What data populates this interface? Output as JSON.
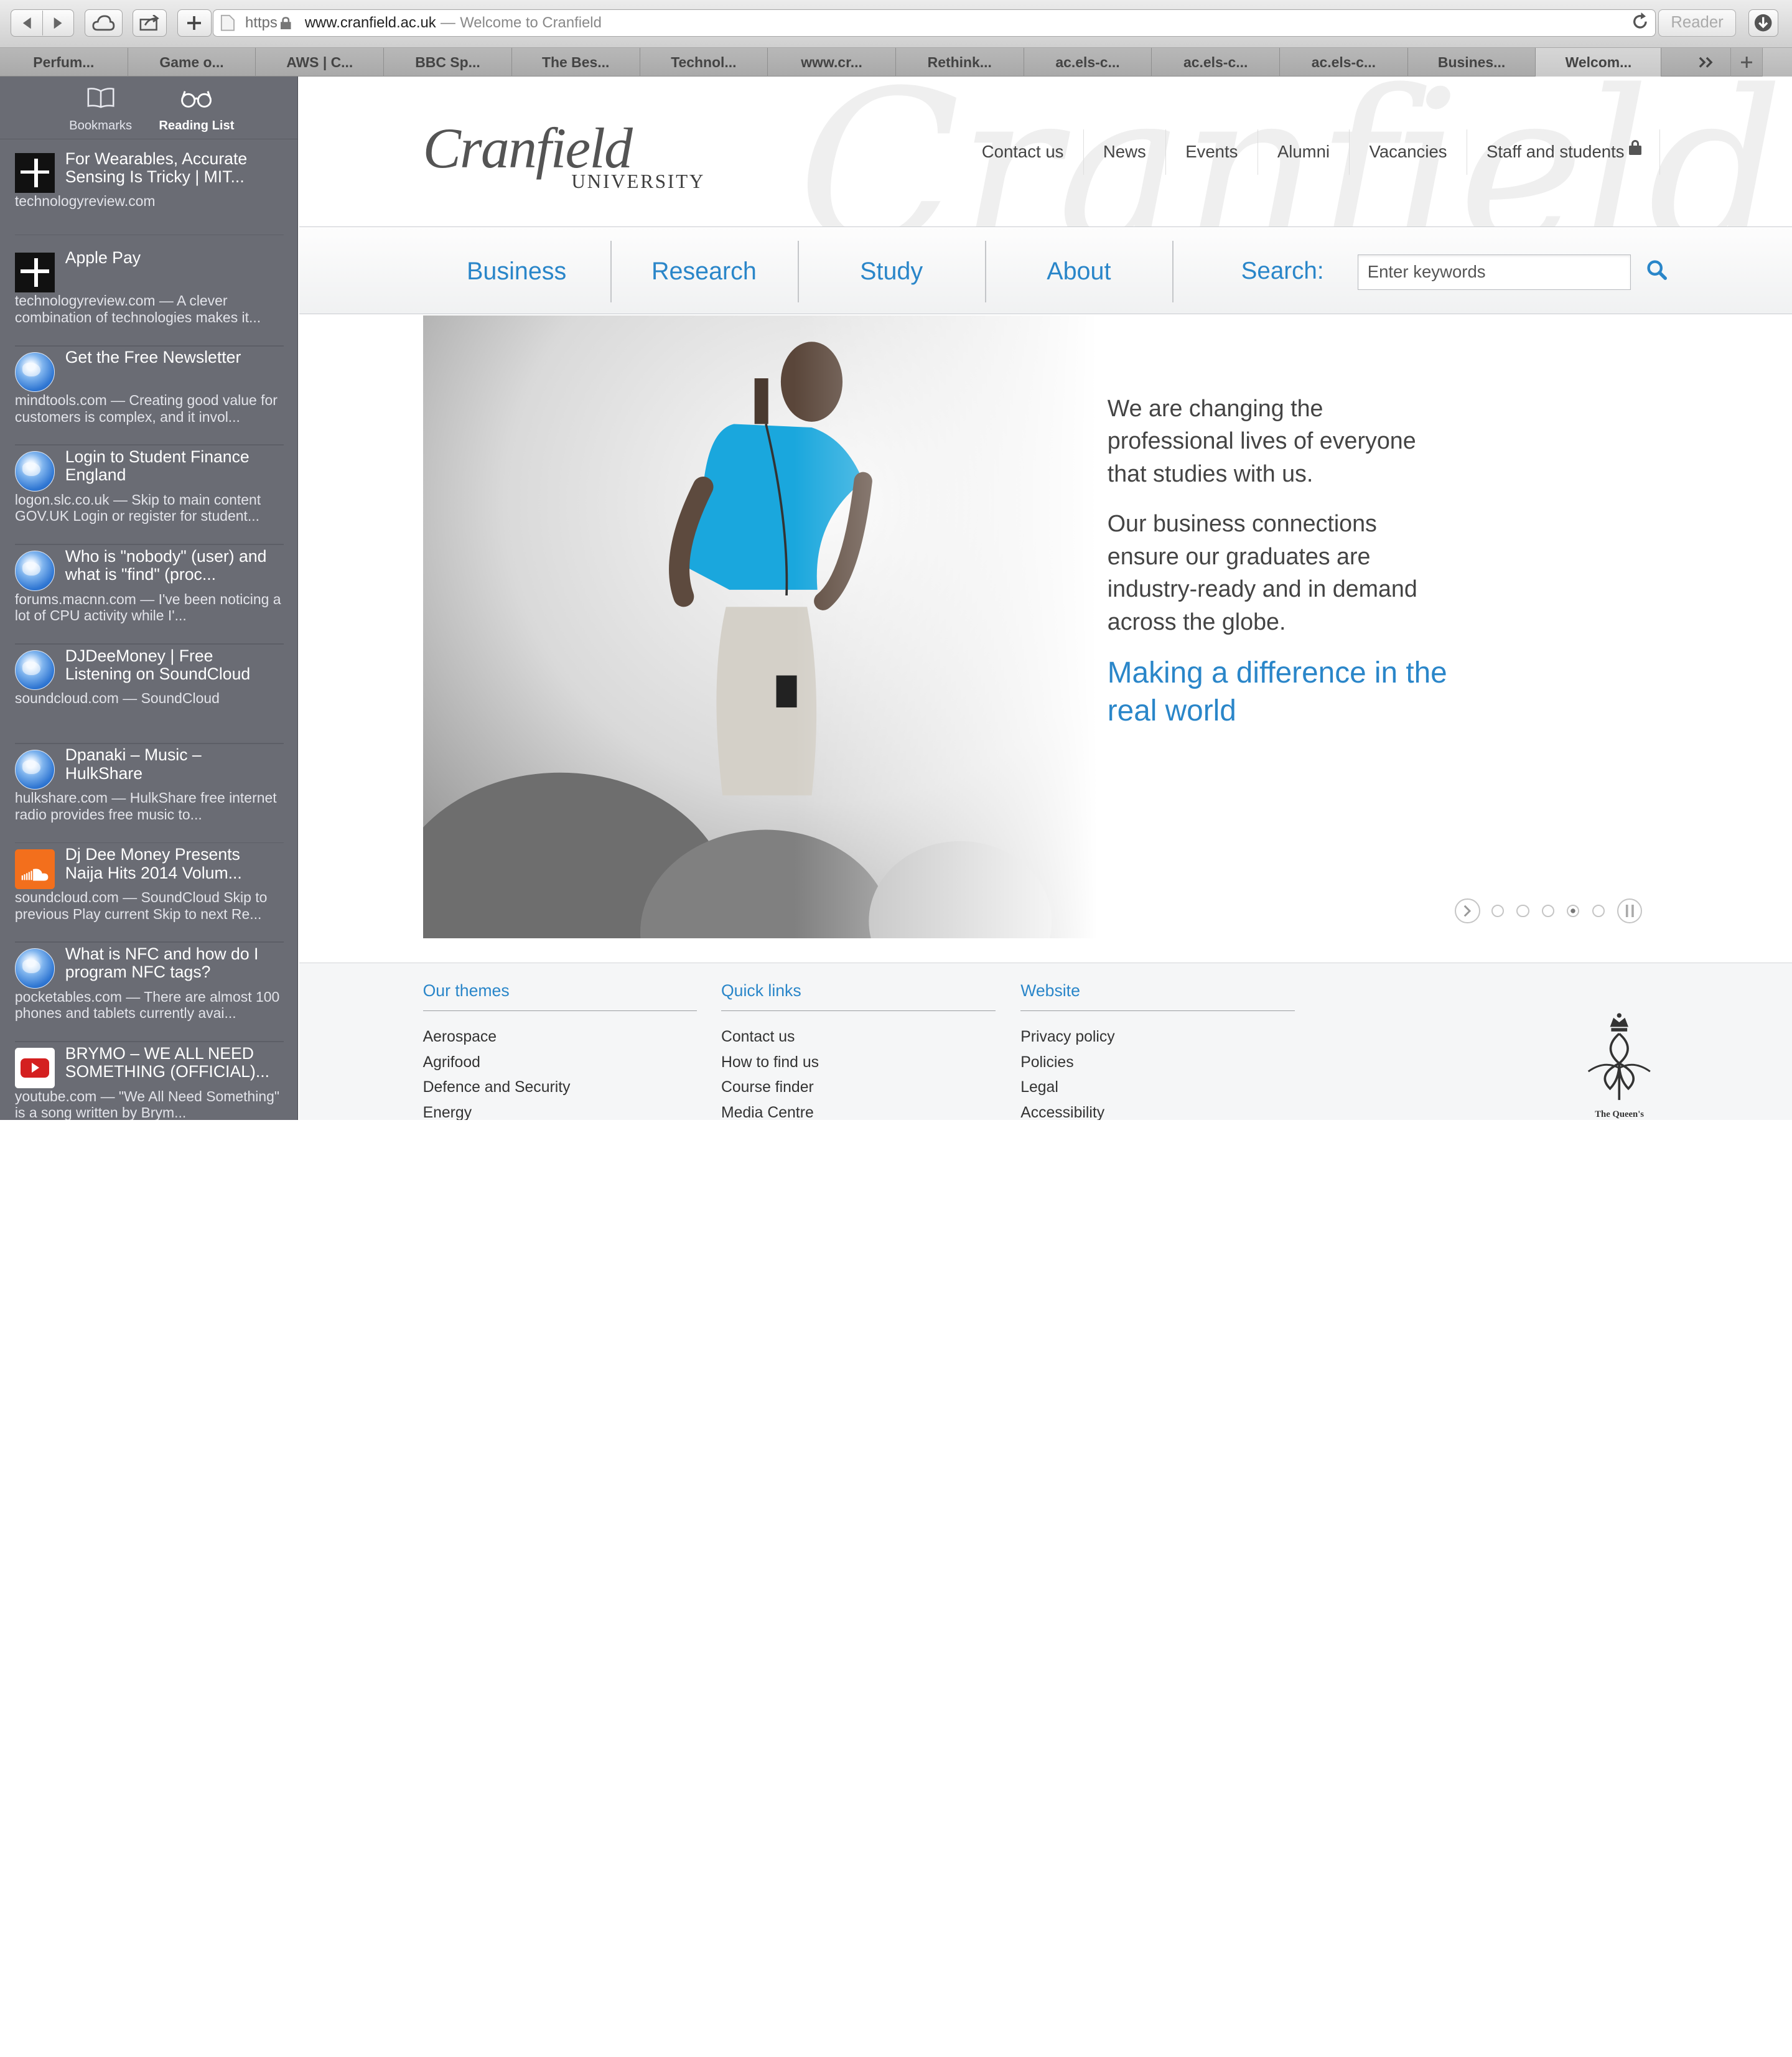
{
  "browser": {
    "address": {
      "scheme": "https",
      "domain": "www.cranfield.ac.uk",
      "separator": "—",
      "title": "Welcome to Cranfield"
    },
    "reader_label": "Reader",
    "tabs": [
      "Perfum...",
      "Game o...",
      "AWS | C...",
      "BBC Sp...",
      "The Bes...",
      "Technol...",
      "www.cr...",
      "Rethink...",
      "ac.els-c...",
      "ac.els-c...",
      "ac.els-c...",
      "Busines...",
      "Welcom..."
    ],
    "active_tab_index": 12
  },
  "sidebar": {
    "tabs": {
      "bookmarks": "Bookmarks",
      "reading_list": "Reading List"
    },
    "items": [
      {
        "icon": "technology-review-icon",
        "title": "For Wearables, Accurate Sensing Is Tricky | MIT...",
        "desc": "technologyreview.com"
      },
      {
        "icon": "technology-review-icon",
        "title": "Apple Pay",
        "desc": "technologyreview.com — A clever combination of technologies makes it..."
      },
      {
        "icon": "globe-icon",
        "title": "Get the Free Newsletter",
        "desc": "mindtools.com — Creating good value for customers is complex, and it invol..."
      },
      {
        "icon": "globe-icon",
        "title": "Login to Student Finance England",
        "desc": "logon.slc.co.uk — Skip to main content GOV.UK Login or register for student..."
      },
      {
        "icon": "globe-icon",
        "title": "Who is \"nobody\" (user) and what is \"find\" (proc...",
        "desc": "forums.macnn.com — I've been noticing a lot of CPU activity while I'..."
      },
      {
        "icon": "globe-icon",
        "title": "DJDeeMoney | Free Listening on SoundCloud",
        "desc": "soundcloud.com — SoundCloud"
      },
      {
        "icon": "globe-icon",
        "title": "Dpanaki – Music – HulkShare",
        "desc": "hulkshare.com — HulkShare free internet radio provides free music to..."
      },
      {
        "icon": "soundcloud-icon",
        "title": "Dj Dee Money Presents Naija Hits 2014 Volum...",
        "desc": "soundcloud.com — SoundCloud Skip to previous Play current Skip to next Re..."
      },
      {
        "icon": "globe-icon",
        "title": "What is NFC and how do I program NFC tags?",
        "desc": "pocketables.com — There are almost 100 phones and tablets currently avai..."
      },
      {
        "icon": "youtube-icon",
        "title": "BRYMO – WE ALL NEED SOMETHING (OFFICIAL)...",
        "desc": "youtube.com — \"We All Need Something\" is a song written by Brym..."
      }
    ]
  },
  "site": {
    "logo": {
      "wordmark": "Cranfield",
      "sub": "UNIVERSITY"
    },
    "watermark": "Cranfield",
    "top_nav": [
      "Contact us",
      "News",
      "Events",
      "Alumni",
      "Vacancies",
      "Staff and students"
    ],
    "main_nav": [
      "Business",
      "Research",
      "Study",
      "About"
    ],
    "search": {
      "label": "Search:",
      "placeholder": "Enter keywords"
    },
    "hero": {
      "p1": "We are changing the professional lives of everyone that studies with us.",
      "p2": "Our business connections ensure our graduates are industry-ready and in demand across the globe.",
      "tagline": "Making a difference in the real world",
      "slides_total": 5,
      "active_slide": 4
    },
    "footer": {
      "themes": {
        "heading": "Our themes",
        "links": [
          "Aerospace",
          "Agrifood",
          "Defence and Security",
          "Energy"
        ]
      },
      "quick": {
        "heading": "Quick links",
        "links": [
          "Contact us",
          "How to find us",
          "Course finder",
          "Media Centre"
        ]
      },
      "website": {
        "heading": "Website",
        "links": [
          "Privacy policy",
          "Policies",
          "Legal",
          "Accessibility"
        ]
      },
      "crest_text": "The Queen's"
    }
  },
  "colors": {
    "accent": "#2a86c9",
    "sidebar": "#6a6c74",
    "body_text": "#444444"
  }
}
